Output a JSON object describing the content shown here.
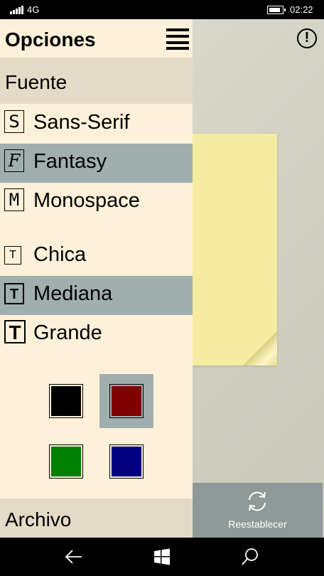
{
  "status_bar": {
    "network": "4G",
    "time": "02:22"
  },
  "panel": {
    "title": "Opciones",
    "font_section": "Fuente",
    "fonts": [
      {
        "glyph": "S",
        "label": "Sans-Serif",
        "selected": false
      },
      {
        "glyph": "F",
        "label": "Fantasy",
        "selected": true
      },
      {
        "glyph": "M",
        "label": "Monospace",
        "selected": false
      }
    ],
    "sizes": [
      {
        "glyph": "T",
        "label": "Chica",
        "selected": false
      },
      {
        "glyph": "T",
        "label": "Mediana",
        "selected": true
      },
      {
        "glyph": "T",
        "label": "Grande",
        "selected": false
      }
    ],
    "colors": [
      {
        "name": "black",
        "hex": "#000000",
        "selected": false
      },
      {
        "name": "dark-red",
        "hex": "#800000",
        "selected": true
      },
      {
        "name": "green",
        "hex": "#008000",
        "selected": false
      },
      {
        "name": "navy",
        "hex": "#000080",
        "selected": false
      }
    ],
    "file_section": "Archivo"
  },
  "reset_button": {
    "label": "Reestablecer",
    "icon": "refresh-icon"
  },
  "colors": {
    "panel_bg": "#fff1d9",
    "section_bg": "#e4dbc7",
    "selected_bg": "#a0aeae",
    "note": "#f5ec9f",
    "reset_bg": "#8f9a98"
  },
  "nav": {
    "back": "back-arrow-icon",
    "home": "windows-logo-icon",
    "search": "search-icon"
  }
}
